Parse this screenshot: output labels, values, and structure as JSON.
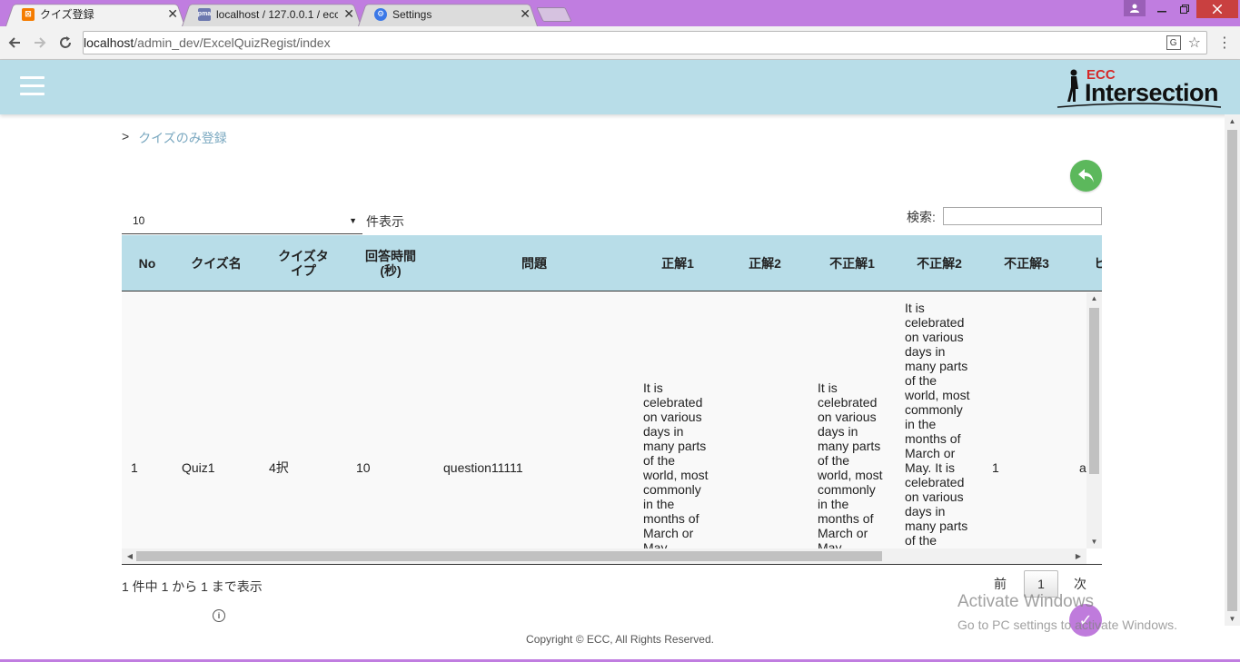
{
  "browser": {
    "tabs": [
      {
        "title": "クイズ登録",
        "favicon": "xampp-icon",
        "favicon_color": "#f57c00",
        "active": true
      },
      {
        "title": "localhost / 127.0.0.1 / ecc",
        "favicon": "phpmyadmin-icon",
        "favicon_color": "#6c78af",
        "active": false
      },
      {
        "title": "Settings",
        "favicon": "gear-icon",
        "favicon_color": "#3b78e7",
        "active": false
      }
    ],
    "close_glyph": "✕",
    "url_host": "localhost",
    "url_path": "/admin_dev/ExcelQuizRegist/index"
  },
  "header": {
    "logo_top": "ECC",
    "logo_main": "Intersection"
  },
  "breadcrumb": {
    "separator": ">",
    "current": "クイズのみ登録"
  },
  "controls": {
    "page_length": "10",
    "page_length_label": "件表示",
    "search_label": "検索:",
    "search_value": ""
  },
  "table": {
    "columns": [
      "No",
      "クイズ名",
      "クイズタイプ",
      "回答時間(秒)",
      "問題",
      "正解1",
      "正解2",
      "不正解1",
      "不正解2",
      "不正解3",
      "ヒ"
    ],
    "column_display": [
      "No",
      "クイズ名",
      "クイズタ\nイプ",
      "回答時間\n(秒)",
      "問題",
      "正解1",
      "正解2",
      "不正解1",
      "不正解2",
      "不正解3",
      "ヒ"
    ],
    "rows": [
      {
        "no": "1",
        "quiz_name": "Quiz1",
        "quiz_type": "4択",
        "answer_time": "10",
        "question": "question11111",
        "correct1": "It is\ncelebrated\non various\ndays in\nmany parts\nof the\nworld, most\ncommonly\nin the\nmonths of\nMarch or\nMay.",
        "correct2": "",
        "wrong1": "It is\ncelebrated\non various\ndays in\nmany parts\nof the\nworld, most\ncommonly\nin the\nmonths of\nMarch or\nMay.",
        "wrong2": "It is\ncelebrated\non various\ndays in\nmany parts\nof the\nworld, most\ncommonly\nin the\nmonths of\nMarch or\nMay. It is\ncelebrated\non various\ndays in\nmany parts\nof the",
        "wrong3": "1",
        "hint": "a"
      }
    ]
  },
  "footer": {
    "info": "1 件中 1 から 1 まで表示",
    "prev": "前",
    "current_page": "1",
    "next": "次",
    "copyright": "Copyright © ECC, All Rights Reserved."
  },
  "watermark": {
    "line1": "Activate Windows",
    "line2": "Go to PC settings to activate Windows."
  },
  "colors": {
    "header_bg": "#b8dde8",
    "back_button": "#5cb85c",
    "breadcrumb_link": "#7aa8c0",
    "logo_red": "#d62828"
  }
}
